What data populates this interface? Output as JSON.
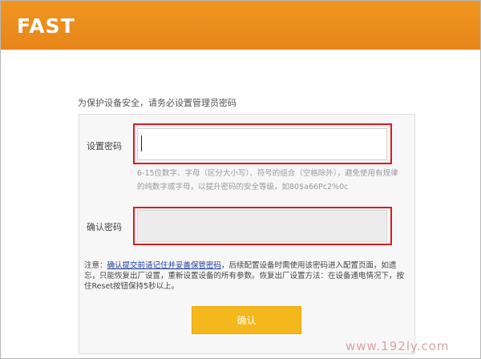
{
  "header": {
    "logo": "FAST",
    "background_color": "#e8861a"
  },
  "intro_text": "为保护设备安全，请务必设置管理员密码",
  "set_password": {
    "label": "设置密码",
    "value": ""
  },
  "password_hint": "6-15位数字、字母（区分大小写）、符号的组合（空格除外），避免使用有规律的纯数字或字母，以提升密码的安全等级，如80$a66Pc2%0c",
  "confirm_password": {
    "label": "确认密码",
    "value": ""
  },
  "note": {
    "prefix": "注意：",
    "link": "确认提交前请记住并妥善保管密码",
    "rest": "，后续配置设备时需使用该密码进入配置页面，如遗忘，只能恢复出厂设置，重新设置设备的所有参数。恢复出厂设置方法：在设备通电情况下，按住Reset按钮保持5秒以上。"
  },
  "confirm_button": "确认",
  "highlight_color": "#e0191f",
  "button_color": "#f4b81c",
  "watermark": "www.192ly.com"
}
